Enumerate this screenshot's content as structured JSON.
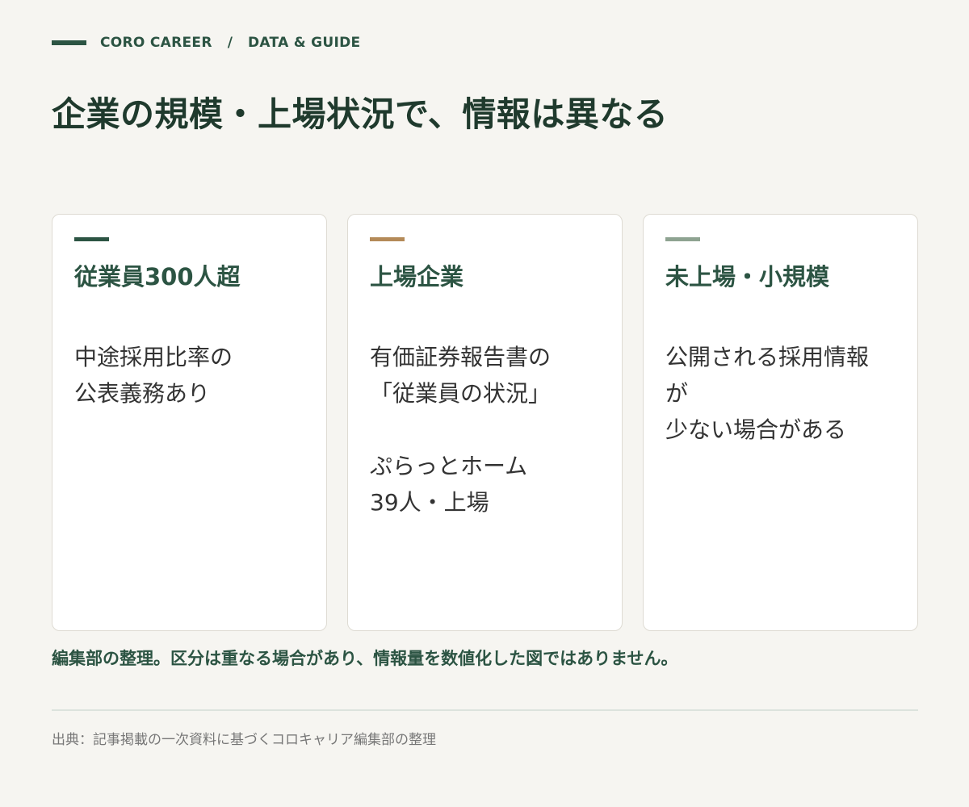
{
  "header": {
    "brand": "CORO CAREER",
    "separator": "/",
    "section": "DATA & GUIDE"
  },
  "title": "企業の規模・上場状況で、情報は異なる",
  "cards": [
    {
      "accent_color": "#2c5443",
      "title": "従業員300人超",
      "lines": [
        "中途採用比率の",
        "公表義務あり"
      ]
    },
    {
      "accent_color": "#b48a58",
      "title": "上場企業",
      "lines": [
        "有価証券報告書の",
        "「従業員の状況」",
        "",
        "ぷらっとホーム",
        "39人・上場"
      ]
    },
    {
      "accent_color": "#8ea391",
      "title": "未上場・小規模",
      "lines": [
        "公開される採用情報",
        "が",
        "少ない場合がある"
      ]
    }
  ],
  "note": "編集部の整理。区分は重なる場合があり、情報量を数値化した図ではありません。",
  "source": "出典：記事掲載の一次資料に基づくコロキャリア編集部の整理"
}
